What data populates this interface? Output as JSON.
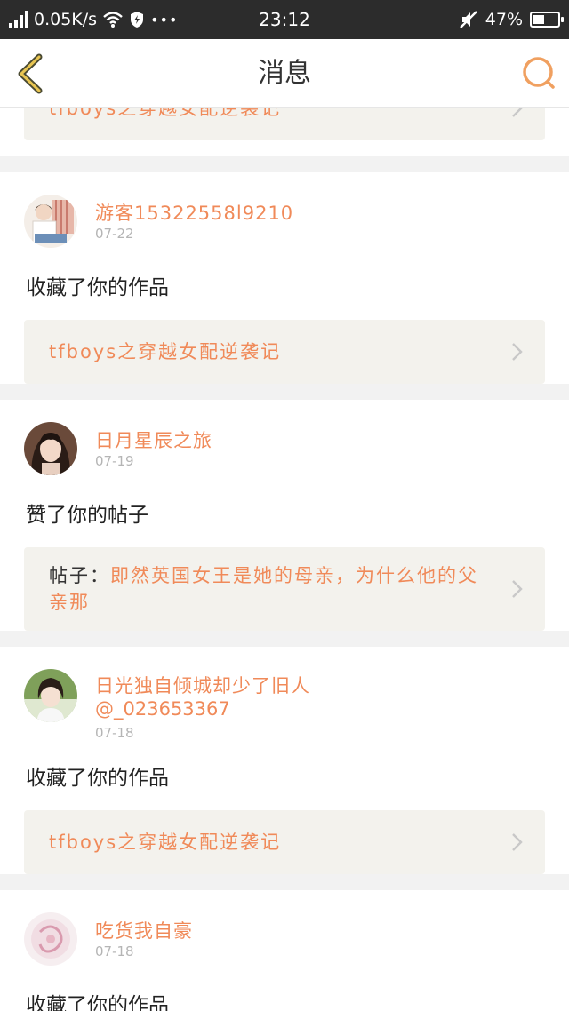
{
  "status_bar": {
    "network_speed": "0.05K/s",
    "time": "23:12",
    "battery_percent": "47%",
    "battery_level": 0.47,
    "dots": "•••"
  },
  "nav": {
    "title": "消息",
    "accent_color": "#f0a060"
  },
  "partial_item": {
    "link": "tfboys之穿越女配逆袭记"
  },
  "items": [
    {
      "name": "游客15322558l9210",
      "date": "07-22",
      "action": "收藏了你的作品",
      "link": "tfboys之穿越女配逆袭记"
    },
    {
      "name": "日月星辰之旅",
      "date": "07-19",
      "action": "赞了你的帖子",
      "link_prefix": "帖子：",
      "link": "即然英国女王是她的母亲，为什么他的父亲那"
    },
    {
      "name": "日光独自倾城却少了旧人",
      "handle": "@_023653367",
      "date": "07-18",
      "action": "收藏了你的作品",
      "link": "tfboys之穿越女配逆袭记"
    },
    {
      "name": "吃货我自豪",
      "date": "07-18",
      "action": "收藏了你的作品"
    }
  ],
  "colors": {
    "name": "#f08a59",
    "date": "#b5b5b5",
    "link_box_bg": "#f3f2ed",
    "status_bar_bg": "#2c2c2c"
  }
}
